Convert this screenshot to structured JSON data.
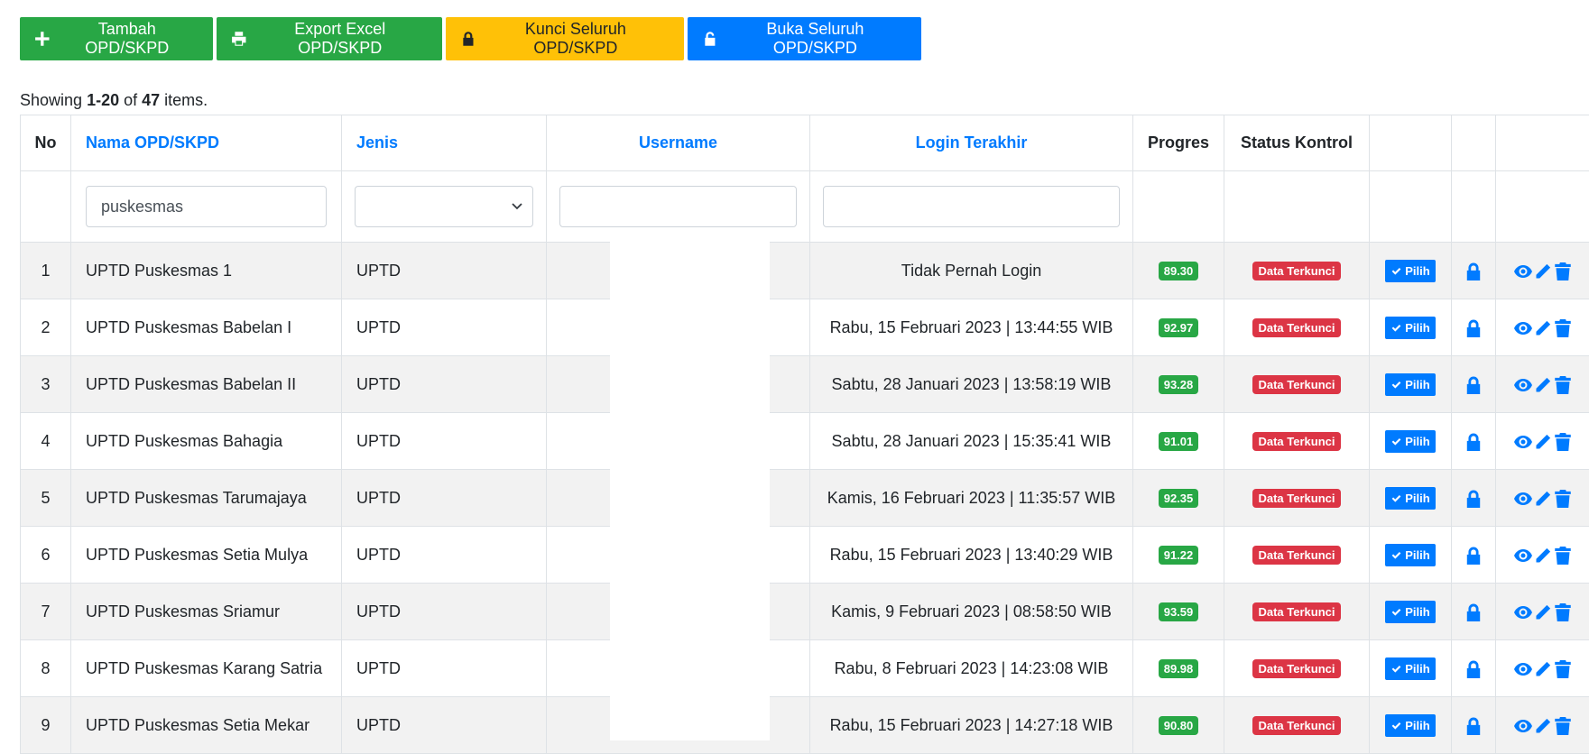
{
  "toolbar": {
    "add_label": "Tambah OPD/SKPD",
    "export_label": "Export Excel OPD/SKPD",
    "lock_all_label": "Kunci Seluruh OPD/SKPD",
    "unlock_all_label": "Buka Seluruh OPD/SKPD"
  },
  "summary": {
    "prefix": "Showing ",
    "range": "1-20",
    "of": " of ",
    "total": "47",
    "suffix": " items."
  },
  "table": {
    "headers": {
      "no": "No",
      "nama": "Nama OPD/SKPD",
      "jenis": "Jenis",
      "username": "Username",
      "login": "Login Terakhir",
      "progres": "Progres",
      "status": "Status Kontrol"
    },
    "filters": {
      "nama": "puskesmas",
      "jenis": "",
      "username": "",
      "login": ""
    },
    "pilih_label": "Pilih",
    "rows": [
      {
        "no": "1",
        "nama": "UPTD Puskesmas 1",
        "jenis": "UPTD",
        "login": "Tidak Pernah Login",
        "progres": "89.30",
        "status": "Data Terkunci"
      },
      {
        "no": "2",
        "nama": "UPTD Puskesmas Babelan I",
        "jenis": "UPTD",
        "login": "Rabu, 15 Februari 2023 | 13:44:55 WIB",
        "progres": "92.97",
        "status": "Data Terkunci"
      },
      {
        "no": "3",
        "nama": "UPTD Puskesmas Babelan II",
        "jenis": "UPTD",
        "login": "Sabtu, 28 Januari 2023 | 13:58:19 WIB",
        "progres": "93.28",
        "status": "Data Terkunci"
      },
      {
        "no": "4",
        "nama": "UPTD Puskesmas Bahagia",
        "jenis": "UPTD",
        "login": "Sabtu, 28 Januari 2023 | 15:35:41 WIB",
        "progres": "91.01",
        "status": "Data Terkunci"
      },
      {
        "no": "5",
        "nama": "UPTD Puskesmas Tarumajaya",
        "jenis": "UPTD",
        "login": "Kamis, 16 Februari 2023 | 11:35:57 WIB",
        "progres": "92.35",
        "status": "Data Terkunci"
      },
      {
        "no": "6",
        "nama": "UPTD Puskesmas Setia Mulya",
        "jenis": "UPTD",
        "login": "Rabu, 15 Februari 2023 | 13:40:29 WIB",
        "progres": "91.22",
        "status": "Data Terkunci"
      },
      {
        "no": "7",
        "nama": "UPTD Puskesmas Sriamur",
        "jenis": "UPTD",
        "login": "Kamis, 9 Februari 2023 | 08:58:50 WIB",
        "progres": "93.59",
        "status": "Data Terkunci"
      },
      {
        "no": "8",
        "nama": "UPTD Puskesmas Karang Satria",
        "jenis": "UPTD",
        "login": "Rabu, 8 Februari 2023 | 14:23:08 WIB",
        "progres": "89.98",
        "status": "Data Terkunci"
      },
      {
        "no": "9",
        "nama": "UPTD Puskesmas Setia Mekar",
        "jenis": "UPTD",
        "login": "Rabu, 15 Februari 2023 | 14:27:18 WIB",
        "progres": "90.80",
        "status": "Data Terkunci"
      }
    ]
  },
  "icons": {
    "add": "plus-icon",
    "export": "printer-icon",
    "lock_all": "lock-icon",
    "unlock_all": "unlock-icon",
    "pilih": "check-icon",
    "row_lock": "lock-icon",
    "view": "eye-icon",
    "edit": "pencil-icon",
    "delete": "trash-icon"
  },
  "colors": {
    "success": "#28a745",
    "warning": "#ffc107",
    "primary": "#007bff",
    "danger": "#dc3545",
    "stripe": "#f2f2f2"
  }
}
